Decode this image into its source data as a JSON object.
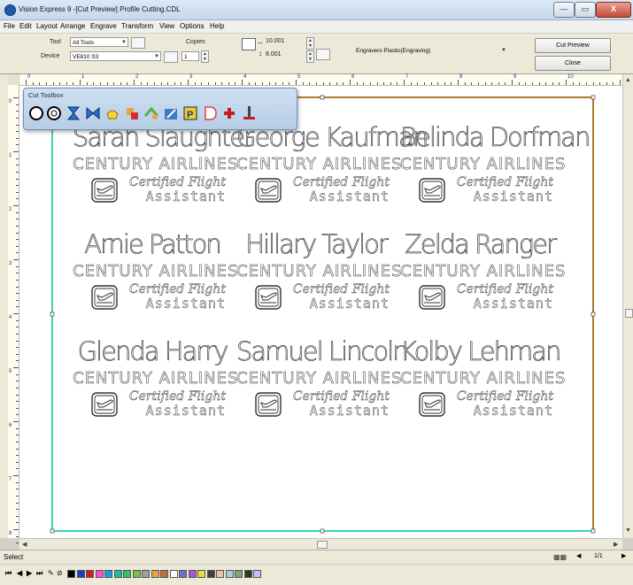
{
  "window": {
    "title": "Vision Express 9 -[Cut Preview] Profile Cutting.CDL",
    "minimize": "—",
    "maximize": "▭",
    "close": "X"
  },
  "menu": [
    "File",
    "Edit",
    "Layout",
    "Arrange",
    "Engrave",
    "Transform",
    "View",
    "Options",
    "Help"
  ],
  "toolbar": {
    "tool_label": "Tool",
    "tool_value": "All Tools",
    "device_label": "Device",
    "device_value": "VE810 S3",
    "copies_label": "Copies",
    "copies_value": "1",
    "width_value": "10.001",
    "height_value": "8.001",
    "material_value": "Engravers Plastic(Engraving)",
    "cut_preview_button": "Cut Preview",
    "close_button": "Close"
  },
  "ruler": {
    "h_marks": [
      "0",
      "1",
      "2",
      "3",
      "4",
      "5",
      "6",
      "7",
      "8",
      "9",
      "10"
    ],
    "v_marks": [
      "0",
      "1",
      "2",
      "3",
      "4",
      "5",
      "6",
      "7",
      "8"
    ]
  },
  "cut_toolbox": {
    "title": "Cut Toolbox",
    "tools": [
      "circle-cut-icon",
      "double-circle-cut-icon",
      "hourglass-icon",
      "bowtie-icon",
      "yellow-shape-icon",
      "stamp-icon",
      "green-arrow-icon",
      "pencil-icon",
      "p-symbol-icon",
      "d-shape-icon",
      "red-tool-icon",
      "router-bit-icon"
    ]
  },
  "labels": [
    {
      "name": "Sarah Slaughter",
      "company": "CENTURY AIRLINES",
      "cert1": "Certified Flight",
      "cert2": "Assistant"
    },
    {
      "name": "George Kaufman",
      "company": "CENTURY AIRLINES",
      "cert1": "Certified Flight",
      "cert2": "Assistant"
    },
    {
      "name": "Belinda Dorfman",
      "company": "CENTURY AIRLINES",
      "cert1": "Certified Flight",
      "cert2": "Assistant"
    },
    {
      "name": "Arnie Patton",
      "company": "CENTURY AIRLINES",
      "cert1": "Certified Flight",
      "cert2": "Assistant"
    },
    {
      "name": "Hillary Taylor",
      "company": "CENTURY AIRLINES",
      "cert1": "Certified Flight",
      "cert2": "Assistant"
    },
    {
      "name": "Zelda Ranger",
      "company": "CENTURY AIRLINES",
      "cert1": "Certified Flight",
      "cert2": "Assistant"
    },
    {
      "name": "Glenda Harry",
      "company": "CENTURY AIRLINES",
      "cert1": "Certified Flight",
      "cert2": "Assistant"
    },
    {
      "name": "Samuel Lincoln",
      "company": "CENTURY AIRLINES",
      "cert1": "Certified Flight",
      "cert2": "Assistant"
    },
    {
      "name": "Kolby Lehman",
      "company": "CENTURY AIRLINES",
      "cert1": "Certified Flight",
      "cert2": "Assistant"
    }
  ],
  "status": {
    "mode": "Select",
    "page": "1/1"
  },
  "palette": [
    "#000000",
    "#1f3fbf",
    "#d02020",
    "#ff50c8",
    "#19a0e0",
    "#19c0a0",
    "#33c35b",
    "#7fbf40",
    "#a0a0a0",
    "#f0a040",
    "#c07030",
    "#ffffff",
    "#7070c0",
    "#b050d0",
    "#e0e040",
    "#404040",
    "#f0c0a0",
    "#a0d0e0",
    "#80a080",
    "#204020",
    "#c0c0ff"
  ],
  "colors": {
    "outer_border": "#b07830",
    "inner_border": "#3cd6b0"
  }
}
